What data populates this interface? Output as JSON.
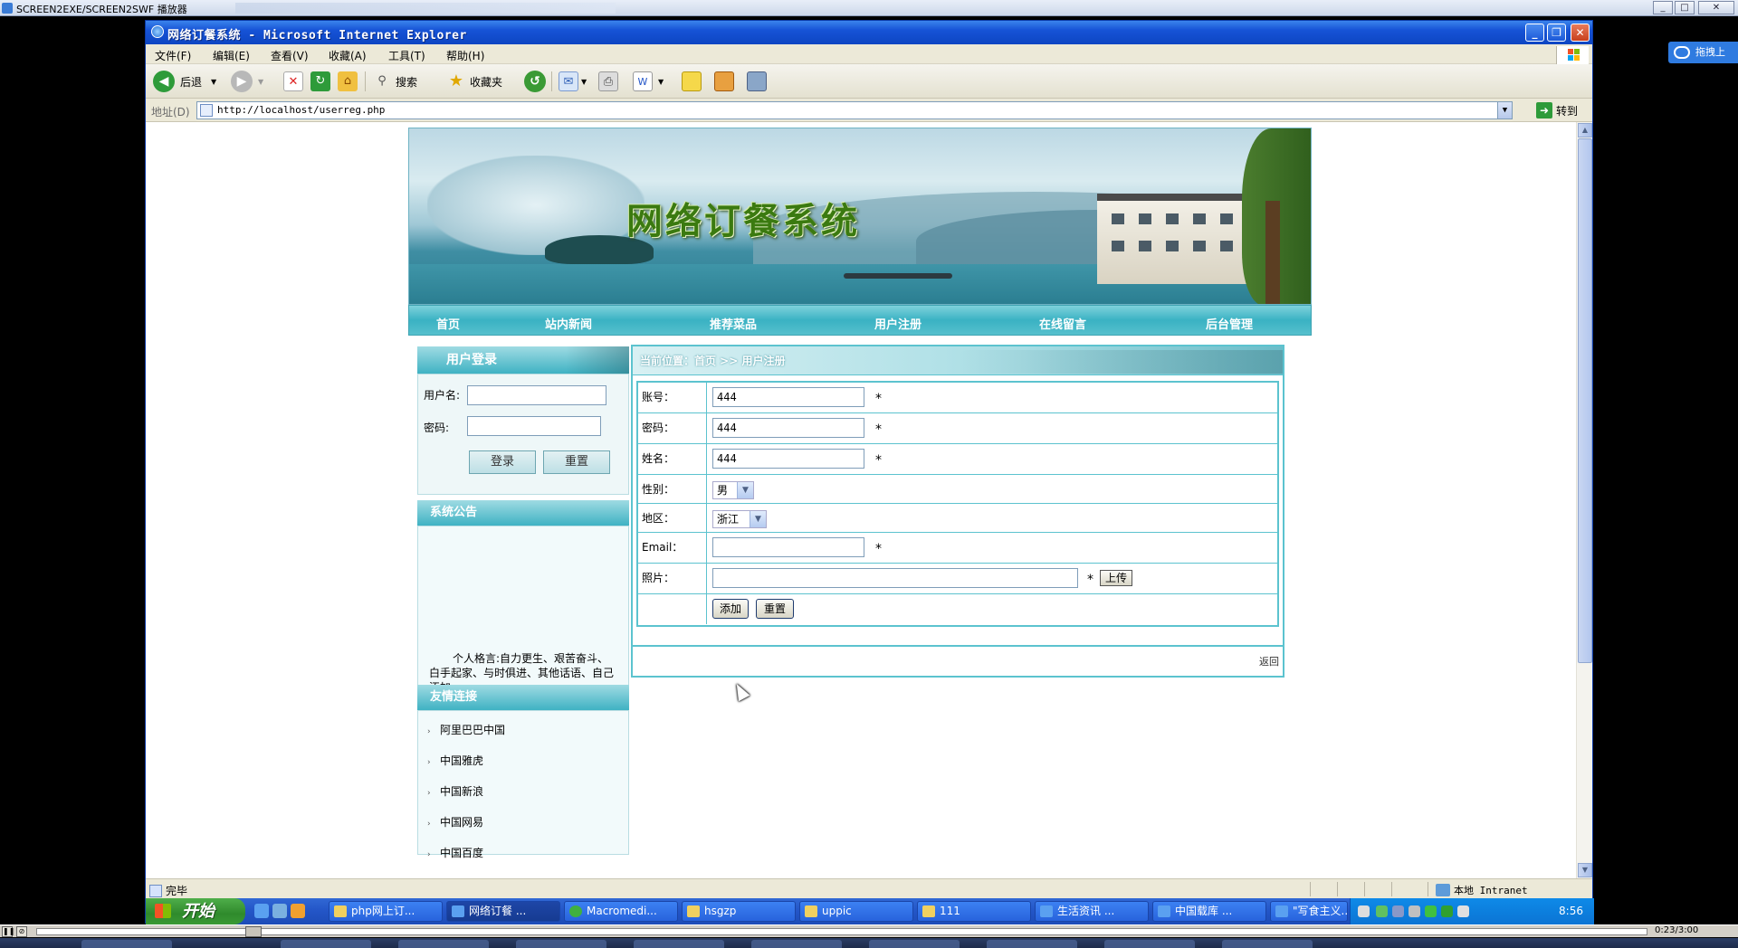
{
  "player": {
    "title": "SCREEN2EXE/SCREEN2SWF 播放器",
    "time": "0:23/3:00",
    "drag_label": "拖拽上"
  },
  "ie": {
    "title": "网络订餐系统 - Microsoft Internet Explorer",
    "menu": [
      "文件(F)",
      "编辑(E)",
      "查看(V)",
      "收藏(A)",
      "工具(T)",
      "帮助(H)"
    ],
    "toolbar": {
      "back": "后退",
      "search": "搜索",
      "favorites": "收藏夹"
    },
    "address_label": "地址(D)",
    "address": "http://localhost/userreg.php",
    "go": "转到",
    "status_text": "完毕",
    "zone": "本地 Intranet"
  },
  "site": {
    "banner_title": "网络订餐系统",
    "nav": [
      "首页",
      "站内新闻",
      "推荐菜品",
      "用户注册",
      "在线留言",
      "后台管理"
    ],
    "login": {
      "heading": "用户登录",
      "username_label": "用户名:",
      "password_label": "密码:",
      "login_button": "登录",
      "reset_button": "重置"
    },
    "notice": {
      "heading": "系统公告",
      "text": "个人格言:自力更生、艰苦奋斗、白手起家、与时俱进、其他话语、自己添加。"
    },
    "links": {
      "heading": "友情连接",
      "items": [
        "阿里巴巴中国",
        "中国雅虎",
        "中国新浪",
        "中国网易",
        "中国百度"
      ]
    },
    "main": {
      "breadcrumb": "当前位置：首页 >> 用户注册",
      "fields": [
        {
          "label": "账号：",
          "value": "444",
          "required": "*"
        },
        {
          "label": "密码：",
          "value": "444",
          "required": "*"
        },
        {
          "label": "姓名：",
          "value": "444",
          "required": "*"
        },
        {
          "label": "性别：",
          "value": "男"
        },
        {
          "label": "地区：",
          "value": "浙江"
        },
        {
          "label": "Email：",
          "value": "",
          "required": "*"
        },
        {
          "label": "照片：",
          "value": "",
          "required": "*",
          "upload": "上传"
        }
      ],
      "add_button": "添加",
      "reset_button": "重置",
      "back_link": "返回"
    }
  },
  "taskbar": {
    "start": "开始",
    "tasks": [
      "php网上订...",
      "网络订餐 ...",
      "Macromedi...",
      "hsgzp",
      "uppic",
      "111",
      "生活资讯 ...",
      "中国载库 ...",
      "\"写食主义..."
    ],
    "clock": "8:56"
  },
  "colors": {
    "accent": "#3ab2c3",
    "xp_blue": "#2456c8",
    "banner_title": "#3b7a10"
  }
}
